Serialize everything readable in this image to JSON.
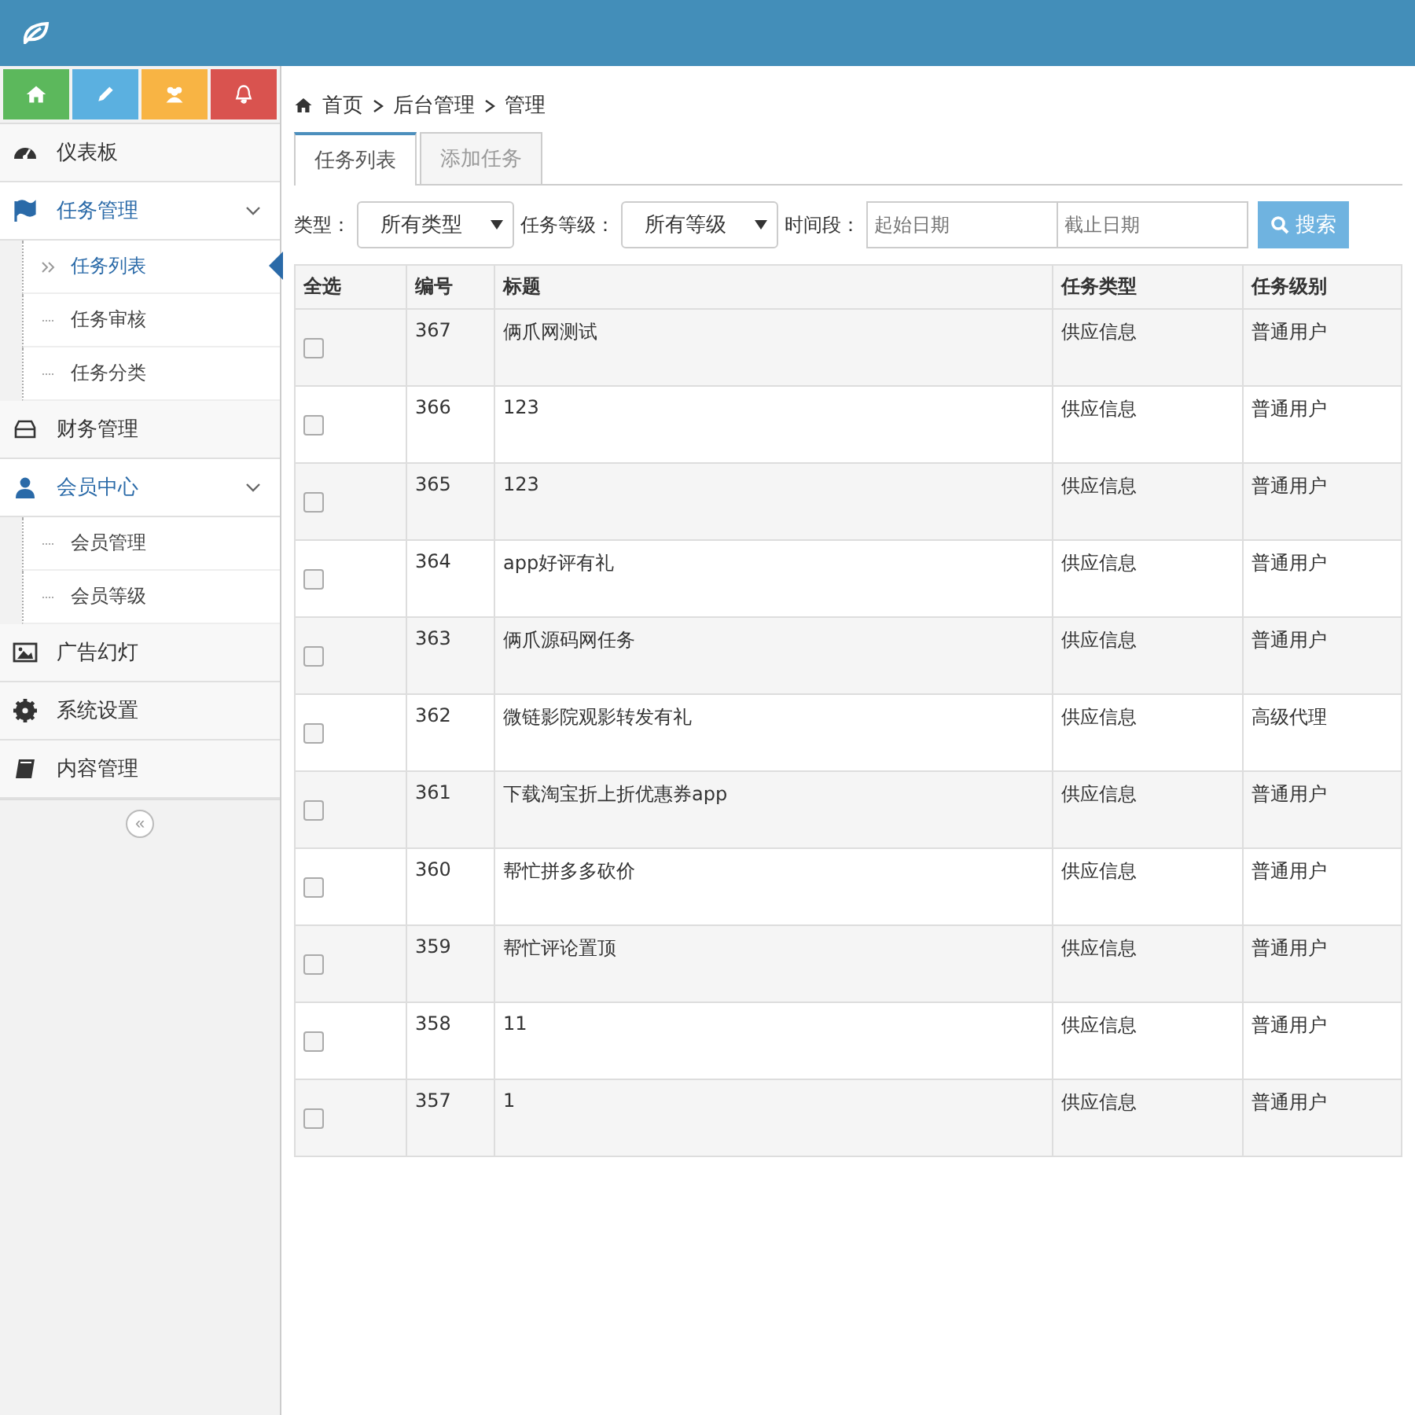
{
  "shortcuts": [
    {
      "kind": "home",
      "color": "#5cb85c"
    },
    {
      "kind": "edit",
      "color": "#5bb0e0"
    },
    {
      "kind": "users",
      "color": "#f8b444"
    },
    {
      "kind": "bell",
      "color": "#d9534f"
    }
  ],
  "sidebar": {
    "items": [
      {
        "label": "仪表板",
        "expanded": false
      },
      {
        "label": "任务管理",
        "expanded": true,
        "children": [
          {
            "label": "任务列表",
            "selected": true
          },
          {
            "label": "任务审核",
            "selected": false
          },
          {
            "label": "任务分类",
            "selected": false
          }
        ]
      },
      {
        "label": "财务管理",
        "expanded": false
      },
      {
        "label": "会员中心",
        "expanded": true,
        "children": [
          {
            "label": "会员管理",
            "selected": false
          },
          {
            "label": "会员等级",
            "selected": false
          }
        ]
      },
      {
        "label": "广告幻灯",
        "expanded": false
      },
      {
        "label": "系统设置",
        "expanded": false
      },
      {
        "label": "内容管理",
        "expanded": false
      }
    ],
    "collapse": "«"
  },
  "breadcrumb": [
    "首页",
    "后台管理",
    "管理"
  ],
  "tabs": [
    {
      "label": "任务列表",
      "selected": true
    },
    {
      "label": "添加任务",
      "selected": false
    }
  ],
  "filters": {
    "type_label": "类型：",
    "type_value": "所有类型",
    "level_label": "任务等级：",
    "level_value": "所有等级",
    "period_label": "时间段：",
    "start_placeholder": "起始日期",
    "end_placeholder": "截止日期",
    "search_button": "搜索"
  },
  "table": {
    "columns": [
      "全选",
      "编号",
      "标题",
      "任务类型",
      "任务级别"
    ],
    "rows": [
      {
        "checked": false,
        "cells": [
          "",
          "367",
          "俩爪网测试",
          "供应信息",
          "普通用户"
        ]
      },
      {
        "checked": false,
        "cells": [
          "",
          "366",
          "123",
          "供应信息",
          "普通用户"
        ]
      },
      {
        "checked": false,
        "cells": [
          "",
          "365",
          "123",
          "供应信息",
          "普通用户"
        ]
      },
      {
        "checked": false,
        "cells": [
          "",
          "364",
          "app好评有礼",
          "供应信息",
          "普通用户"
        ]
      },
      {
        "checked": false,
        "cells": [
          "",
          "363",
          "俩爪源码网任务",
          "供应信息",
          "普通用户"
        ]
      },
      {
        "checked": false,
        "cells": [
          "",
          "362",
          "微链影院观影转发有礼",
          "供应信息",
          "高级代理"
        ]
      },
      {
        "checked": false,
        "cells": [
          "",
          "361",
          "下载淘宝折上折优惠券app",
          "供应信息",
          "普通用户"
        ]
      },
      {
        "checked": false,
        "cells": [
          "",
          "360",
          "帮忙拼多多砍价",
          "供应信息",
          "普通用户"
        ]
      },
      {
        "checked": false,
        "cells": [
          "",
          "359",
          "帮忙评论置顶",
          "供应信息",
          "普通用户"
        ]
      },
      {
        "checked": false,
        "cells": [
          "",
          "358",
          "11",
          "供应信息",
          "普通用户"
        ]
      },
      {
        "checked": false,
        "cells": [
          "",
          "357",
          "1",
          "供应信息",
          "普通用户"
        ]
      }
    ]
  }
}
